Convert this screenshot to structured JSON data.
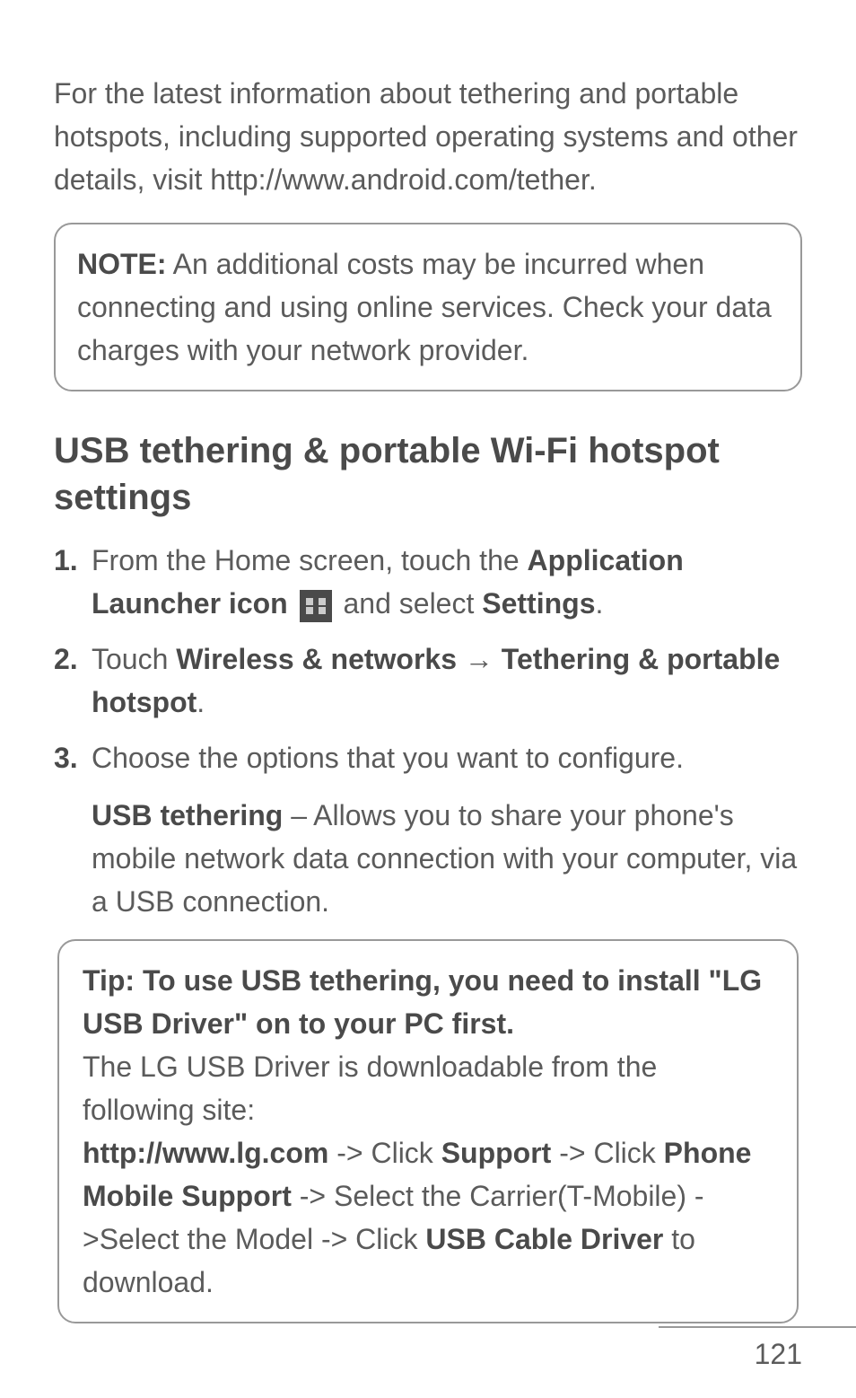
{
  "intro": {
    "text": "For the latest information about tethering and portable hotspots, including supported operating systems and other details, visit http://www.android.com/tether."
  },
  "note": {
    "label": "NOTE:",
    "text": " An additional costs may be incurred when connecting and using online services. Check your data charges with your network provider."
  },
  "heading": "USB tethering & portable Wi-Fi hotspot settings",
  "steps": {
    "s1": {
      "pre": "From the Home screen, touch the ",
      "bold1": "Application Launcher icon",
      "mid": " and select ",
      "bold2": "Settings",
      "post": "."
    },
    "s2": {
      "pre": "Touch ",
      "bold1": "Wireless & networks",
      "arrow": " → ",
      "bold2": "Tethering & portable hotspot",
      "post": "."
    },
    "s3": {
      "line1": "Choose the options that you want to configure.",
      "sub_bold": "USB tethering",
      "sub_text": " – Allows you to share your phone's mobile network data connection with your computer, via a USB connection."
    }
  },
  "tip": {
    "title": "Tip: To use USB tethering, you need to install \"LG USB Driver\" on to your PC first.",
    "line2": "The LG USB Driver is downloadable from the following site:",
    "url": "http://www.lg.com",
    "t1": " -> Click ",
    "b1": "Support",
    "t2": " -> Click ",
    "b2": "Phone Mobile Support",
    "t3": " -> Select the Carrier(T-Mobile) ->Select the Model -> Click ",
    "b3": "USB Cable Driver",
    "t4": " to download."
  },
  "pageNumber": "121"
}
